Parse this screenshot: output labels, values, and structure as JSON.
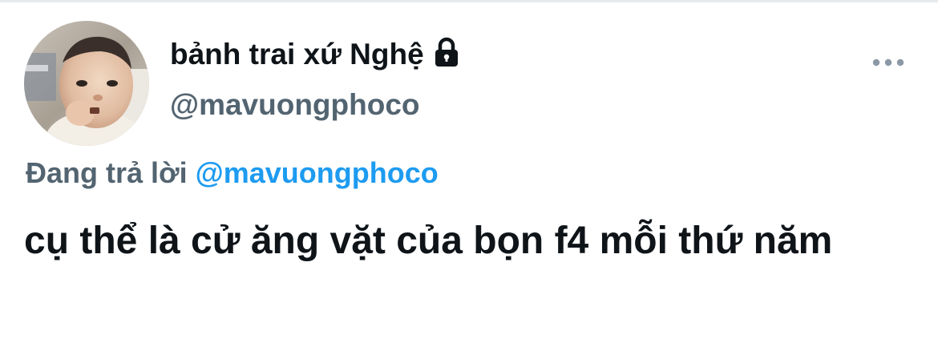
{
  "tweet": {
    "display_name": "bảnh trai xứ Nghệ",
    "handle": "@mavuongphoco",
    "lock_icon": "lock-icon",
    "more_icon": "more-options-icon",
    "reply_prefix": "Đang trả lời",
    "reply_to": "@mavuongphoco",
    "text": "cụ thể là cử ăng vặt của bọn f4 mỗi thứ năm"
  },
  "colors": {
    "text_primary": "#0f1419",
    "text_secondary": "#536471",
    "accent_link": "#1d9bf0",
    "more_dots": "#8b98a5"
  }
}
